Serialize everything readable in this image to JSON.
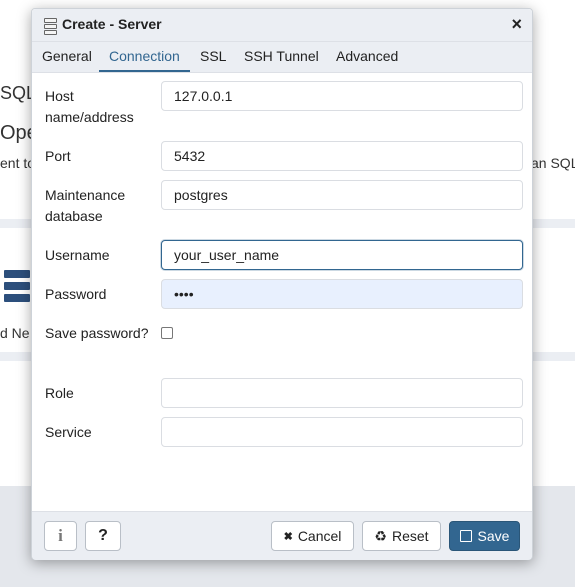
{
  "background": {
    "text_sql": "SQL",
    "text_ope": "Ope",
    "text_ent_to": "ent to",
    "text_an_sql": "an SQL",
    "text_d_ne": "d Ne"
  },
  "dialog": {
    "title": "Create - Server",
    "close_glyph": "×"
  },
  "tabs": [
    {
      "label": "General"
    },
    {
      "label": "Connection"
    },
    {
      "label": "SSL"
    },
    {
      "label": "SSH Tunnel"
    },
    {
      "label": "Advanced"
    }
  ],
  "active_tab": "Connection",
  "form": {
    "host": {
      "label": "Host name/address",
      "value": "127.0.0.1"
    },
    "port": {
      "label": "Port",
      "value": "5432"
    },
    "maintenance_db": {
      "label": "Maintenance database",
      "value": "postgres"
    },
    "username": {
      "label": "Username",
      "value": "your_user_name"
    },
    "password": {
      "label": "Password",
      "value": "••••"
    },
    "save_password": {
      "label": "Save password?",
      "checked": false
    },
    "role": {
      "label": "Role",
      "value": ""
    },
    "service": {
      "label": "Service",
      "value": ""
    }
  },
  "footer": {
    "info_icon": "info-icon",
    "help_label": "?",
    "cancel_label": "Cancel",
    "cancel_icon": "✖",
    "reset_label": "Reset",
    "reset_icon": "♻",
    "save_label": "Save",
    "save_icon": "💾"
  },
  "colors": {
    "accent": "#326690",
    "autofill": "#e8f0fe",
    "header_bg": "#ebeef3"
  }
}
